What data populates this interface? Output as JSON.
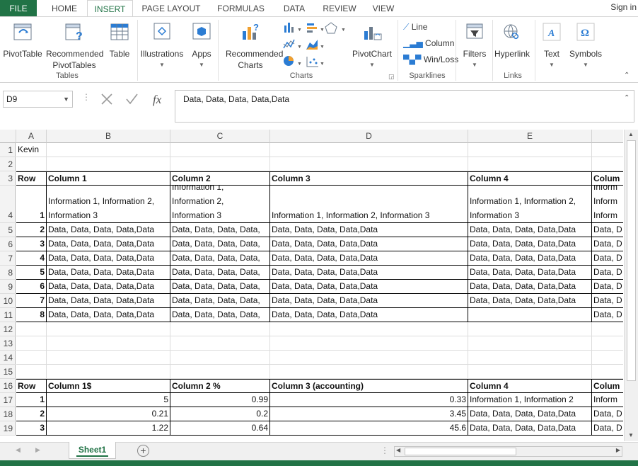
{
  "tabs": [
    "FILE",
    "HOME",
    "INSERT",
    "PAGE LAYOUT",
    "FORMULAS",
    "DATA",
    "REVIEW",
    "VIEW"
  ],
  "signin": "Sign in",
  "ribbon": {
    "pivottable": "PivotTable",
    "recommended_pivottables": "Recommended PivotTables",
    "table": "Table",
    "group_tables": "Tables",
    "illustrations": "Illustrations",
    "apps": "Apps",
    "recommended_charts": "Recommended Charts",
    "pivotchart": "PivotChart",
    "group_charts": "Charts",
    "spark_line": "Line",
    "spark_column": "Column",
    "spark_winloss": "Win/Loss",
    "group_sparklines": "Sparklines",
    "filters": "Filters",
    "hyperlink": "Hyperlink",
    "group_links": "Links",
    "text": "Text",
    "symbols": "Symbols"
  },
  "formula_bar": {
    "name_box": "D9",
    "fx": "fx",
    "formula": "Data, Data, Data, Data,Data"
  },
  "columns": [
    "A",
    "B",
    "C",
    "D",
    "E"
  ],
  "row_numbers": [
    "1",
    "2",
    "3",
    "4",
    "5",
    "6",
    "7",
    "8",
    "9",
    "10",
    "11",
    "12",
    "13",
    "14",
    "15",
    "16",
    "17",
    "18",
    "19"
  ],
  "cells": {
    "a1": "Kevin",
    "h_row": "Row",
    "h_c1": "Column 1",
    "h_c2": "Column 2",
    "h_c3": "Column 3",
    "h_c4": "Column 4",
    "h_c5": "Colum",
    "r4": {
      "a": "1",
      "b": "Information 1, Information 2, Information 3",
      "c": "Information 1, Information 2, Information 3",
      "d": "Information 1, Information 2, Information 3",
      "e": "Information 1, Information 2, Information 3",
      "f": "Inform Inform Inform"
    },
    "data_rows": [
      {
        "a": "2",
        "b": "Data, Data, Data, Data,Data",
        "c": "Data, Data, Data, Data,",
        "d": "Data, Data, Data, Data,Data",
        "e": "Data, Data, Data, Data,Data",
        "f": "Data, D"
      },
      {
        "a": "3",
        "b": "Data, Data, Data, Data,Data",
        "c": "Data, Data, Data, Data,",
        "d": "Data, Data, Data, Data,Data",
        "e": "Data, Data, Data, Data,Data",
        "f": "Data, D"
      },
      {
        "a": "4",
        "b": "Data, Data, Data, Data,Data",
        "c": "Data, Data, Data, Data,",
        "d": "Data, Data, Data, Data,Data",
        "e": "Data, Data, Data, Data,Data",
        "f": "Data, D"
      },
      {
        "a": "5",
        "b": "Data, Data, Data, Data,Data",
        "c": "Data, Data, Data, Data,",
        "d": "Data, Data, Data, Data,Data",
        "e": "Data, Data, Data, Data,Data",
        "f": "Data, D"
      },
      {
        "a": "6",
        "b": "Data, Data, Data, Data,Data",
        "c": "Data, Data, Data, Data,",
        "d": "Data, Data, Data, Data,Data",
        "e": "Data, Data, Data, Data,Data",
        "f": "Data, D"
      },
      {
        "a": "7",
        "b": "Data, Data, Data, Data,Data",
        "c": "Data, Data, Data, Data,",
        "d": "Data, Data, Data, Data,Data",
        "e": "Data, Data, Data, Data,Data",
        "f": "Data, D"
      },
      {
        "a": "8",
        "b": "Data, Data, Data, Data,Data",
        "c": "Data, Data, Data, Data,",
        "d": "Data, Data, Data, Data,Data",
        "e": "",
        "f": "Data, D"
      }
    ],
    "h2_row": "Row",
    "h2_c1": "Column 1$",
    "h2_c2": "Column 2 %",
    "h2_c3": "Column 3 (accounting)",
    "h2_c4": "Column 4",
    "h2_c5": "Colum",
    "num_rows": [
      {
        "a": "1",
        "b": "5",
        "c": "0.99",
        "d": "0.33",
        "e": "Information 1, Information 2",
        "f": "Inform"
      },
      {
        "a": "2",
        "b": "0.21",
        "c": "0.2",
        "d": "3.45",
        "e": "Data, Data, Data, Data,Data",
        "f": "Data, D"
      },
      {
        "a": "3",
        "b": "1.22",
        "c": "0.64",
        "d": "45.6",
        "e": "Data, Data, Data, Data,Data",
        "f": "Data, D"
      }
    ]
  },
  "sheet_tab": "Sheet1",
  "colors": {
    "accent": "#217346"
  }
}
